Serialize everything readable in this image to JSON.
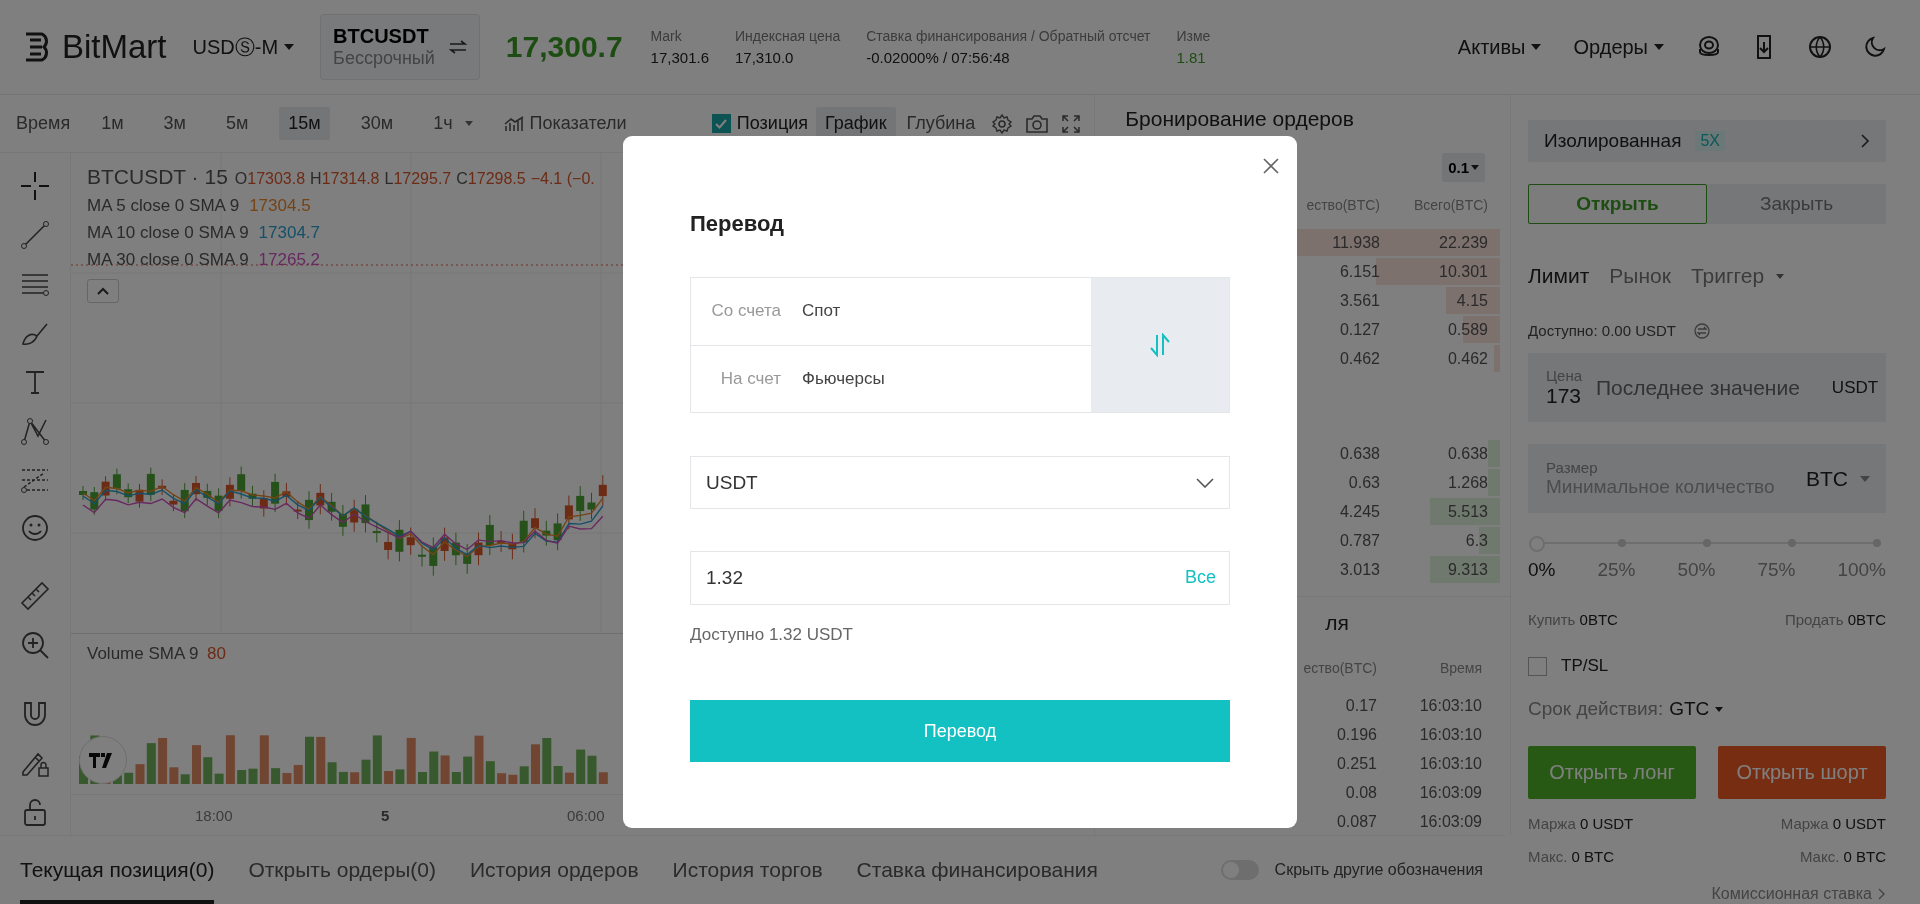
{
  "header": {
    "logo": "BitMart",
    "contract_type": "USDⓈ-M",
    "symbol": "BTCUSDT",
    "symbol_type": "Бессрочный",
    "last_price": "17,300.7",
    "stats": [
      {
        "label": "Mark",
        "value": "17,301.6",
        "kind": "plain"
      },
      {
        "label": "Индексная цена",
        "value": "17,310.0",
        "kind": "plain"
      },
      {
        "label": "Ставка финансирования / Обратный отсчет",
        "value": "-0.02000% / 07:56:48",
        "kind": "plain"
      },
      {
        "label": "Изме",
        "value": "1.81",
        "kind": "change"
      }
    ],
    "menus": [
      {
        "label": "Активы"
      },
      {
        "label": "Ордеры"
      }
    ]
  },
  "chart_toolbar": {
    "label": "Время",
    "intervals": [
      {
        "label": "1м",
        "selected": false,
        "dropdown": false
      },
      {
        "label": "3м",
        "selected": false,
        "dropdown": false
      },
      {
        "label": "5м",
        "selected": false,
        "dropdown": false
      },
      {
        "label": "15м",
        "selected": true,
        "dropdown": false
      },
      {
        "label": "30м",
        "selected": false,
        "dropdown": false
      },
      {
        "label": "1ч",
        "selected": false,
        "dropdown": true
      }
    ],
    "indicators": "Показатели",
    "position": {
      "label": "Позиция",
      "checked": true
    },
    "views": [
      {
        "label": "График",
        "selected": true
      },
      {
        "label": "Глубина",
        "selected": false
      }
    ]
  },
  "chart": {
    "symbol": "BTCUSDT · 15",
    "ohlc": [
      {
        "key": "O",
        "value": "17303.8"
      },
      {
        "key": "H",
        "value": "17314.8"
      },
      {
        "key": "L",
        "value": "17295.7"
      },
      {
        "key": "C",
        "value": "17298.5"
      }
    ],
    "change": "−4.1 (−0.",
    "ma": [
      {
        "label": "MA 5 close 0 SMA 9",
        "value": "17304.5"
      },
      {
        "label": "MA 10 close 0 SMA 9",
        "value": "17304.7"
      },
      {
        "label": "MA 30 close 0 SMA 9",
        "value": "17265.2"
      }
    ],
    "volume": {
      "label": "Volume SMA 9",
      "value": "80"
    },
    "time_labels": [
      {
        "label": "18:00",
        "kind": "time"
      },
      {
        "label": "5",
        "kind": "day"
      },
      {
        "label": "06:00",
        "kind": "time"
      }
    ]
  },
  "order_book": {
    "title": "Бронирование ордеров",
    "precision": "0.1",
    "columns": [
      "ество(BTC)",
      "Всего(BTC)"
    ],
    "asks": [
      {
        "amount": "11.938",
        "total": "22.239"
      },
      {
        "amount": "6.151",
        "total": "10.301"
      },
      {
        "amount": "3.561",
        "total": "4.15"
      },
      {
        "amount": "0.127",
        "total": "0.589"
      },
      {
        "amount": "0.462",
        "total": "0.462"
      }
    ],
    "bids": [
      {
        "amount": "0.638",
        "total": "0.638"
      },
      {
        "amount": "0.63",
        "total": "1.268"
      },
      {
        "amount": "4.245",
        "total": "5.513"
      },
      {
        "amount": "0.787",
        "total": "6.3"
      },
      {
        "amount": "3.013",
        "total": "9.313"
      }
    ]
  },
  "trades": {
    "title": "ля",
    "columns": [
      "ество(BTC)",
      "Время"
    ],
    "rows": [
      {
        "amount": "0.17",
        "time": "16:03:10"
      },
      {
        "amount": "0.196",
        "time": "16:03:10"
      },
      {
        "amount": "0.251",
        "time": "16:03:10"
      },
      {
        "amount": "0.08",
        "time": "16:03:09"
      },
      {
        "amount": "0.087",
        "time": "16:03:09"
      }
    ]
  },
  "bottom": {
    "tabs": [
      {
        "label": "Текущая позиция(0)",
        "selected": true
      },
      {
        "label": "Открыть ордеры(0)",
        "selected": false
      },
      {
        "label": "История ордеров",
        "selected": false
      },
      {
        "label": "История торгов",
        "selected": false
      },
      {
        "label": "Ставка финансирования",
        "selected": false
      }
    ],
    "hide_others": {
      "label": "Скрыть другие обозначения",
      "on": false
    }
  },
  "trade_panel": {
    "margin_mode": "Изолированная",
    "leverage": "5X",
    "sides": [
      {
        "label": "Открыть",
        "selected": true
      },
      {
        "label": "Закрыть",
        "selected": false
      }
    ],
    "order_types": [
      {
        "label": "Лимит",
        "selected": true,
        "dropdown": false
      },
      {
        "label": "Рынок",
        "selected": false,
        "dropdown": false
      },
      {
        "label": "Триггер",
        "selected": false,
        "dropdown": true
      }
    ],
    "available": "Доступно: 0.00 USDT",
    "price": {
      "label": "Цена",
      "value": "173",
      "option": "Последнее значение",
      "unit": "USDT"
    },
    "size": {
      "label": "Размер",
      "placeholder": "Минимальное количество",
      "unit": "BTC"
    },
    "slider": {
      "level": 0,
      "marks": [
        "0%",
        "25%",
        "50%",
        "75%",
        "100%"
      ]
    },
    "buy": {
      "label": "Купить",
      "value": "0BTC"
    },
    "sell": {
      "label": "Продать",
      "value": "0BTC"
    },
    "tpsl": {
      "label": "TP/SL",
      "checked": false
    },
    "validity": {
      "label": "Срок действия:",
      "value": "GTC"
    },
    "long_button": "Открыть лонг",
    "short_button": "Открыть шорт",
    "margins": [
      {
        "label": "Маржа",
        "value": "0 USDT"
      },
      {
        "label": "Маржа",
        "value": "0 USDT"
      }
    ],
    "max": [
      {
        "label": "Макс.",
        "value": "0 BTC"
      },
      {
        "label": "Макс.",
        "value": "0 BTC"
      }
    ],
    "fee_link": "Комиссионная ставка"
  },
  "modal": {
    "title": "Перевод",
    "from": {
      "label": "Со счета",
      "value": "Спот"
    },
    "to": {
      "label": "На счет",
      "value": "Фьючерсы"
    },
    "currency": "USDT",
    "amount": "1.32",
    "all_link": "Все",
    "available": "Доступно 1.32 USDT",
    "submit": "Перевод"
  }
}
